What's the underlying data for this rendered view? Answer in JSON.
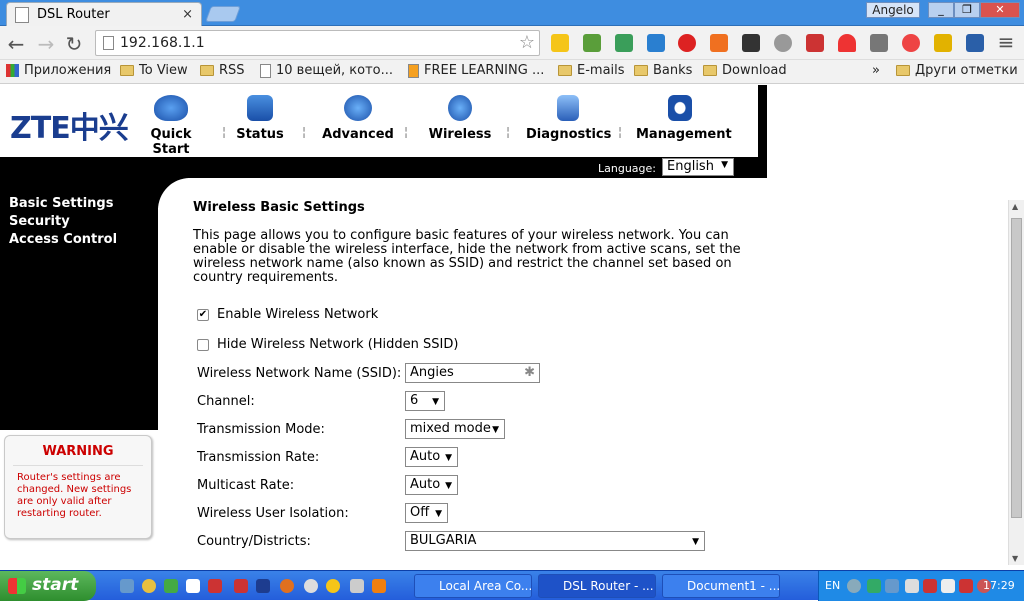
{
  "browser": {
    "tab_title": "DSL Router",
    "tab_close": "×",
    "user": "Angelo",
    "window_buttons": [
      "_",
      "❐",
      "✕"
    ],
    "url": "192.168.1.1",
    "nav_back": "←",
    "nav_forward": "→",
    "nav_reload": "↻",
    "menu_icon": "≡"
  },
  "bookmarks": {
    "items": [
      "Приложения",
      "To View",
      "RSS",
      "10 вещей, кото...",
      "FREE LEARNING ...",
      "E-mails",
      "Banks",
      "Download"
    ],
    "overflow": "»",
    "other": "Други отметки"
  },
  "router": {
    "logo": "ZTE中兴",
    "menu": [
      "Quick Start",
      "Status",
      "Advanced",
      "Wireless",
      "Diagnostics",
      "Management"
    ],
    "language_label": "Language:",
    "language_value": "English",
    "side_links": [
      "Basic Settings",
      "Security",
      "Access Control"
    ],
    "warning": {
      "title": "WARNING",
      "message": "Router's settings are changed. New settings are only valid after restarting router."
    }
  },
  "main": {
    "title": "Wireless Basic Settings",
    "description": "This page allows you to configure basic features of your wireless network. You can enable or disable the wireless interface, hide the network from active scans, set the wireless network name (also known as SSID) and restrict the channel set based on country requirements.",
    "enable_label": "Enable Wireless Network",
    "enable_checked": true,
    "hide_label": "Hide Wireless Network (Hidden SSID)",
    "hide_checked": false,
    "ssid_label": "Wireless Network Name (SSID):",
    "ssid_value": "Angies",
    "channel_label": "Channel:",
    "channel_value": "6",
    "mode_label": "Transmission Mode:",
    "mode_value": "mixed mode",
    "rate_label": "Transmission Rate:",
    "rate_value": "Auto",
    "multicast_label": "Multicast Rate:",
    "multicast_value": "Auto",
    "isolation_label": "Wireless User Isolation:",
    "isolation_value": "Off",
    "country_label": "Country/Districts:",
    "country_value": "BULGARIA"
  },
  "taskbar": {
    "start": "start",
    "tasks": [
      "Local Area Co...",
      "DSL Router - ...",
      "Document1 - ..."
    ],
    "lang": "EN",
    "clock": "17:29"
  }
}
